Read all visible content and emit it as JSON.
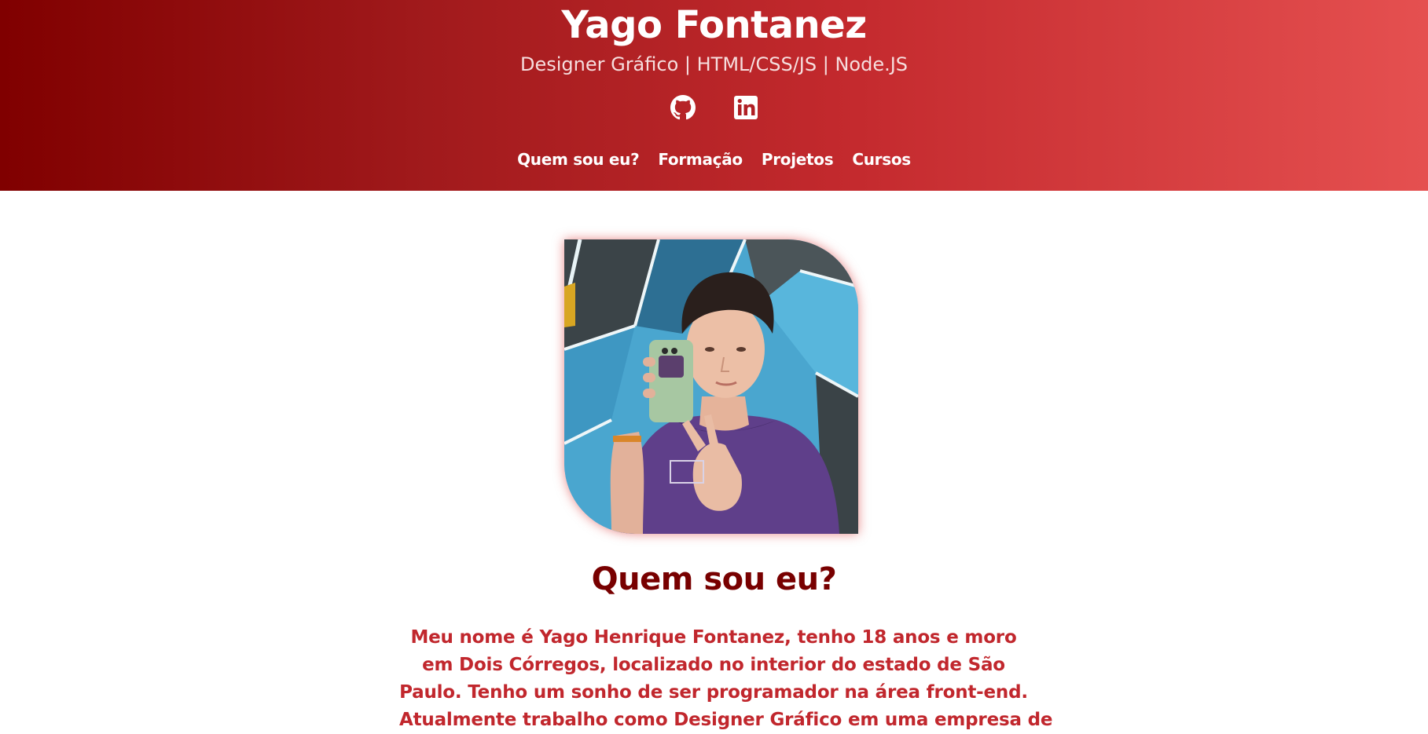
{
  "header": {
    "title": "Yago Fontanez",
    "subtitle": "Designer Gráfico | HTML/CSS/JS | Node.JS",
    "social": [
      {
        "icon": "github-icon"
      },
      {
        "icon": "linkedin-icon"
      }
    ],
    "nav": [
      {
        "label": "Quem sou eu?"
      },
      {
        "label": "Formação"
      },
      {
        "label": "Projetos"
      },
      {
        "label": "Cursos"
      }
    ]
  },
  "about": {
    "title": "Quem sou eu?",
    "bio_lines": [
      "Meu nome é Yago Henrique Fontanez, tenho 18 anos e moro",
      "em Dois Córregos, localizado no interior do estado de São",
      "Paulo. Tenho um sonho de ser programador na área front-end.",
      "Atualmente trabalho como Designer Gráfico em uma empresa de"
    ]
  },
  "colors": {
    "gradient_start": "#800000",
    "gradient_end": "#e55050",
    "title_dark_red": "#780000",
    "bio_red": "#c1272d"
  }
}
